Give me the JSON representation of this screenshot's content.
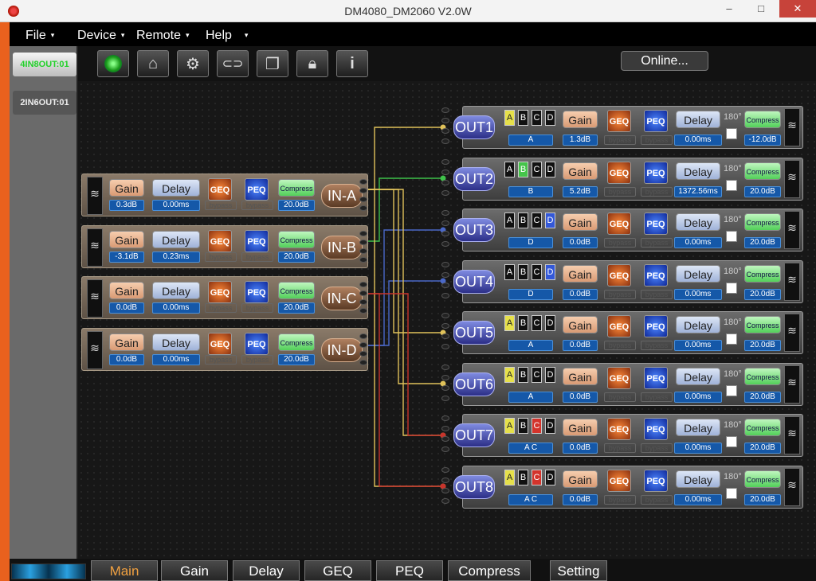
{
  "window": {
    "title": "DM4080_DM2060 V2.0W",
    "min": "–",
    "max": "□",
    "close": "✕"
  },
  "menus": [
    "File",
    "Device",
    "Remote",
    "Help"
  ],
  "menu_arrow": "▾",
  "sidebar": [
    {
      "label": "4IN8OUT:01",
      "selected": true
    },
    {
      "label": "2IN6OUT:01",
      "selected": false
    }
  ],
  "toolbar": {
    "icons": [
      "status-led-icon",
      "home-icon",
      "gear-icon",
      "link-icon",
      "windows-icon",
      "lock-icon",
      "info-icon"
    ],
    "status": "Online..."
  },
  "labels": {
    "gain": "Gain",
    "delay": "Delay",
    "geq": "GEQ",
    "peq": "PEQ",
    "compress": "Compress",
    "bypass": "bypass",
    "phase": "180°"
  },
  "inputs": [
    {
      "name": "IN-A",
      "gain": "0.3dB",
      "delay": "0.00ms",
      "compress": "20.0dB"
    },
    {
      "name": "IN-B",
      "gain": "-3.1dB",
      "delay": "0.23ms",
      "compress": "20.0dB"
    },
    {
      "name": "IN-C",
      "gain": "0.0dB",
      "delay": "0.00ms",
      "compress": "20.0dB"
    },
    {
      "name": "IN-D",
      "gain": "0.0dB",
      "delay": "0.00ms",
      "compress": "20.0dB"
    }
  ],
  "outputs": [
    {
      "name": "OUT1",
      "sources": "A",
      "active": [
        "A"
      ],
      "gain": "1.3dB",
      "delay": "0.00ms",
      "compress": "-12.0dB"
    },
    {
      "name": "OUT2",
      "sources": "B",
      "active": [
        "B"
      ],
      "gain": "5.2dB",
      "delay": "1372.56ms",
      "compress": "20.0dB"
    },
    {
      "name": "OUT3",
      "sources": "D",
      "active": [
        "D"
      ],
      "gain": "0.0dB",
      "delay": "0.00ms",
      "compress": "20.0dB"
    },
    {
      "name": "OUT4",
      "sources": "D",
      "active": [
        "D"
      ],
      "gain": "0.0dB",
      "delay": "0.00ms",
      "compress": "20.0dB"
    },
    {
      "name": "OUT5",
      "sources": "A",
      "active": [
        "A"
      ],
      "gain": "0.0dB",
      "delay": "0.00ms",
      "compress": "20.0dB"
    },
    {
      "name": "OUT6",
      "sources": "A",
      "active": [
        "A"
      ],
      "gain": "0.0dB",
      "delay": "0.00ms",
      "compress": "20.0dB"
    },
    {
      "name": "OUT7",
      "sources": "A C",
      "active": [
        "A",
        "C"
      ],
      "gain": "0.0dB",
      "delay": "0.00ms",
      "compress": "20.0dB"
    },
    {
      "name": "OUT8",
      "sources": "A C",
      "active": [
        "A",
        "C"
      ],
      "gain": "0.0dB",
      "delay": "0.00ms",
      "compress": "20.0dB"
    }
  ],
  "channel_letters": [
    "A",
    "B",
    "C",
    "D"
  ],
  "route_colors": {
    "A": "#e0c25a",
    "B": "#3fc24a",
    "C": "#c8342c",
    "D": "#4a68c8"
  },
  "tabs": [
    {
      "label": "Main",
      "active": true
    },
    {
      "label": "Gain"
    },
    {
      "label": "Delay"
    },
    {
      "label": "GEQ"
    },
    {
      "label": "PEQ"
    },
    {
      "label": "Compress"
    },
    {
      "label": "Setting"
    }
  ]
}
